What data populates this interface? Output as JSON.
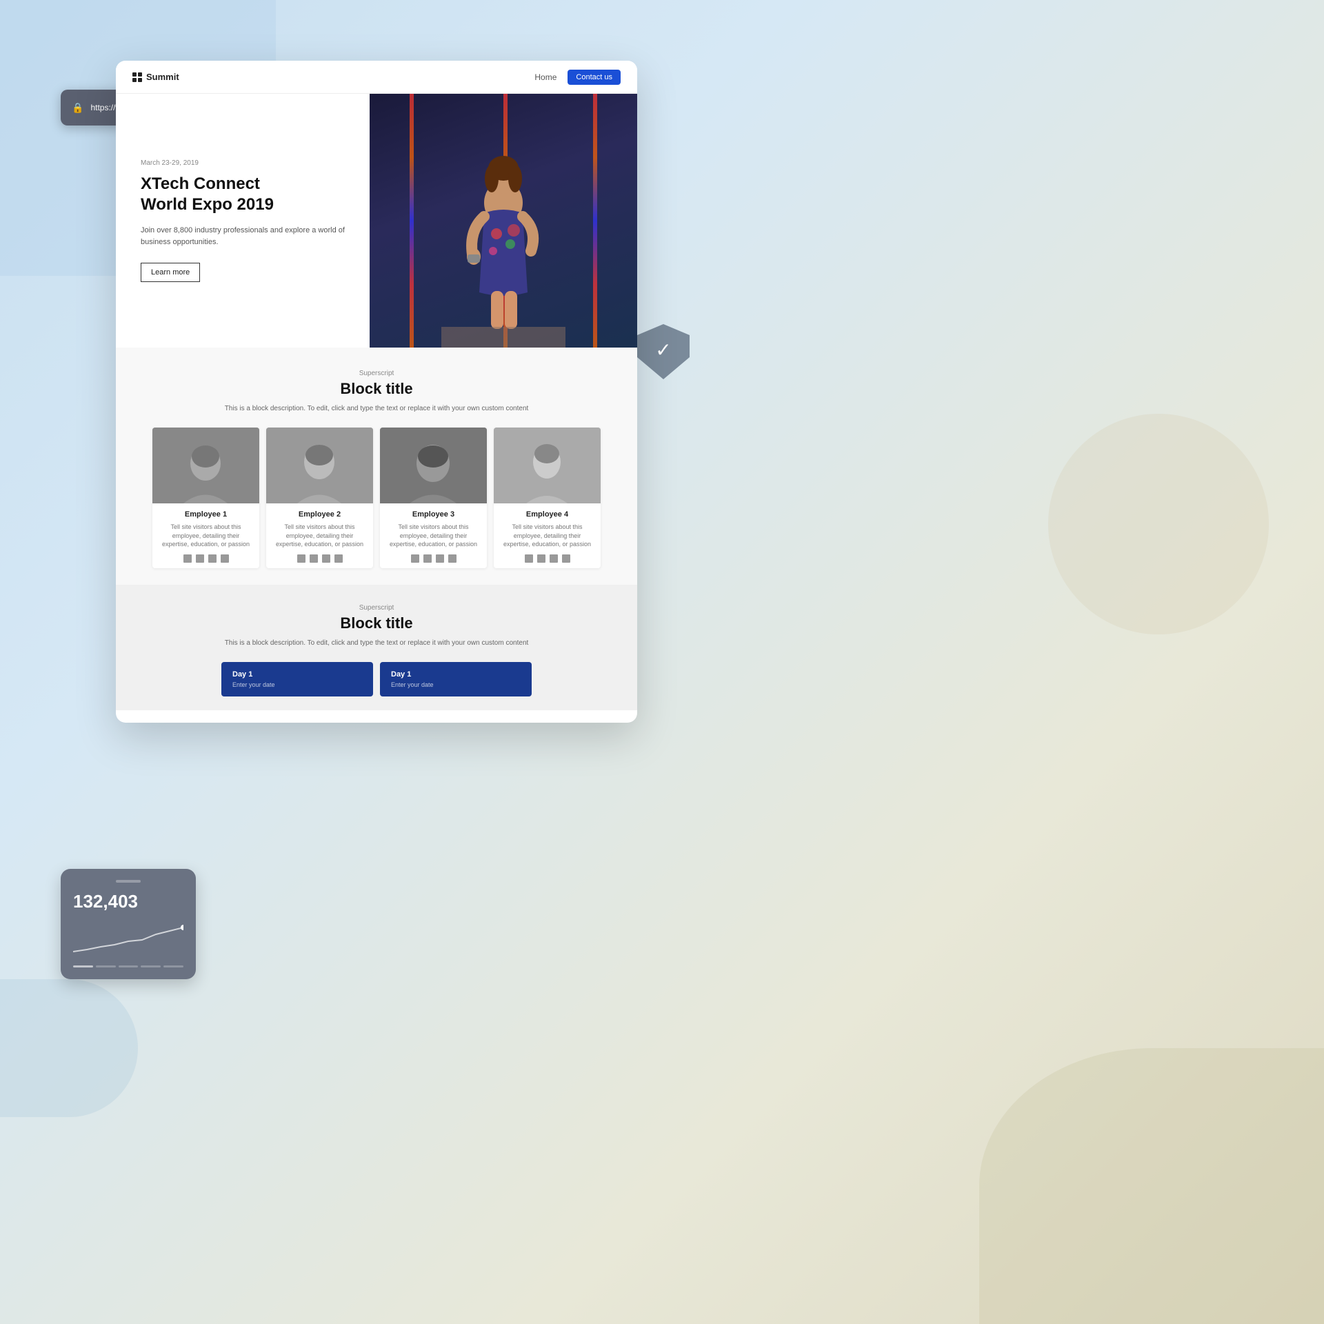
{
  "url_bar": {
    "url": "https://www.yourdomain.com",
    "lock_icon": "🔒"
  },
  "browser": {
    "nav": {
      "logo_text": "Summit",
      "home_link": "Home",
      "contact_button": "Contact us"
    },
    "hero": {
      "date": "March 23-29, 2019",
      "title_line1": "XTech Connect",
      "title_line2": "World Expo 2019",
      "description": "Join over 8,800 industry professionals and explore a world of business opportunities.",
      "cta_button": "Learn more"
    },
    "block1": {
      "superscript": "Superscript",
      "title": "Block title",
      "description": "This is a block description. To edit, click and type the text or replace it with your own custom content"
    },
    "employees": [
      {
        "name": "Employee 1",
        "bio": "Tell site visitors about this employee, detailing their expertise, education, or passion",
        "social_icons": [
          "f",
          "ig",
          "x",
          "email"
        ]
      },
      {
        "name": "Employee 2",
        "bio": "Tell site visitors about this employee, detailing their expertise, education, or passion",
        "social_icons": [
          "f",
          "ig",
          "x",
          "email"
        ]
      },
      {
        "name": "Employee 3",
        "bio": "Tell site visitors about this employee, detailing their expertise, education, or passion",
        "social_icons": [
          "f",
          "ig",
          "x",
          "email"
        ]
      },
      {
        "name": "Employee 4",
        "bio": "Tell site visitors about this employee, detailing their expertise, education, or passion",
        "social_icons": [
          "f",
          "ig",
          "x",
          "email"
        ]
      }
    ],
    "block2": {
      "superscript": "Superscript",
      "title": "Block title",
      "description": "This is a block description. To edit, click and type the text or replace it with your own custom content"
    },
    "day_cards": [
      {
        "label": "Day 1",
        "sub": "Enter your date"
      },
      {
        "label": "Day 1",
        "sub": "Enter your date"
      }
    ]
  },
  "analytics": {
    "number": "132,403"
  },
  "shield": {
    "check": "✓"
  },
  "colors": {
    "accent_blue": "#1a4fd6",
    "nav_dark": "#1a3a8f",
    "shield_gray": "#7a8a9a",
    "analytics_gray": "#6a7282"
  }
}
